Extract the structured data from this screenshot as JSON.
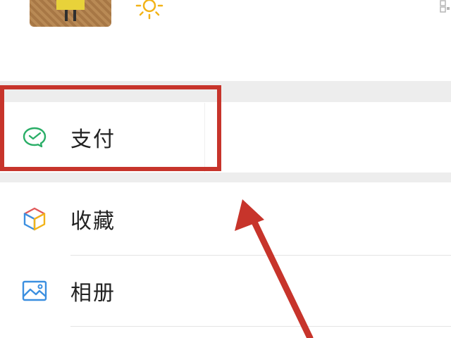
{
  "menu": {
    "pay": {
      "label": "支付",
      "icon": "wechat-pay-icon"
    },
    "favorites": {
      "label": "收藏",
      "icon": "cube-icon"
    },
    "album": {
      "label": "相册",
      "icon": "picture-icon"
    }
  },
  "profile": {
    "avatar_icon": "avatar",
    "status_icon": "sun-icon",
    "qr_icon": "qr-code-icon"
  },
  "annotation": {
    "highlight_color": "#c7342b",
    "arrow_color": "#c7342b"
  },
  "colors": {
    "pay_green": "#2aae67",
    "separator": "#ededed"
  }
}
